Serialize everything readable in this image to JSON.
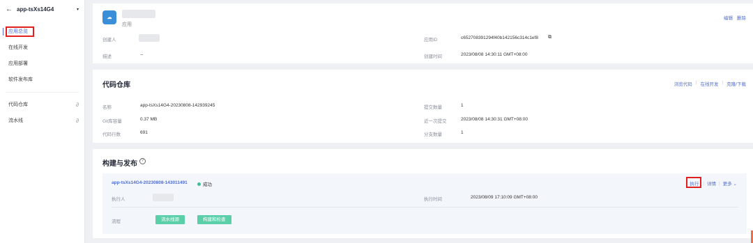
{
  "sidebar": {
    "back_icon": "arrow-left-icon",
    "app_name": "app-tsXs14G4",
    "caret": "▾",
    "items": [
      {
        "label": "应用总览",
        "active": true
      },
      {
        "label": "在线开发"
      },
      {
        "label": "应用部署"
      },
      {
        "label": "软件发布库"
      }
    ],
    "links": [
      {
        "label": "代码仓库",
        "icon": "link-icon"
      },
      {
        "label": "流水线",
        "icon": "link-icon"
      }
    ]
  },
  "app_card": {
    "type_label": "应用",
    "actions": {
      "edit": "编辑",
      "delete": "删除"
    },
    "creator_label": "创建人",
    "desc_label": "描述",
    "desc_value": "--",
    "app_id_label": "应用ID",
    "app_id_value": "c652708391294f40b142156c314c1ef8",
    "created_label": "创建时间",
    "created_value": "2023/08/08 14:30:11 GMT+08:00"
  },
  "repo_card": {
    "title": "代码仓库",
    "actions": {
      "browse": "浏览代码",
      "online_dev": "在线开发",
      "clone": "克隆/下载"
    },
    "name_label": "名称",
    "name_value": "app-tsXs14G4-20230808-142939245",
    "git_size_label": "Git库容量",
    "git_size_value": "0.37 MB",
    "lines_label": "代码行数",
    "lines_value": "691",
    "commits_label": "提交数量",
    "commits_value": "1",
    "last_commit_label": "近一次提交",
    "last_commit_value": "2023/08/08 14:30:31 GMT+08:00",
    "branches_label": "分支数量",
    "branches_value": "1"
  },
  "build_card": {
    "title": "构建与发布",
    "help_icon": "question-circle-icon",
    "run_name": "app-tsXs14G4-20230808-143011491",
    "status": "成功",
    "status_color": "#3ac295",
    "actions": {
      "execute": "执行",
      "details": "详情",
      "more": "更多"
    },
    "executor_label": "执行人",
    "exec_time_label": "执行时间",
    "exec_time_value": "2023/08/09 17:10:09 GMT+08:00",
    "flow_label": "流程",
    "stages": [
      "流水线源",
      "构建和检查"
    ]
  }
}
